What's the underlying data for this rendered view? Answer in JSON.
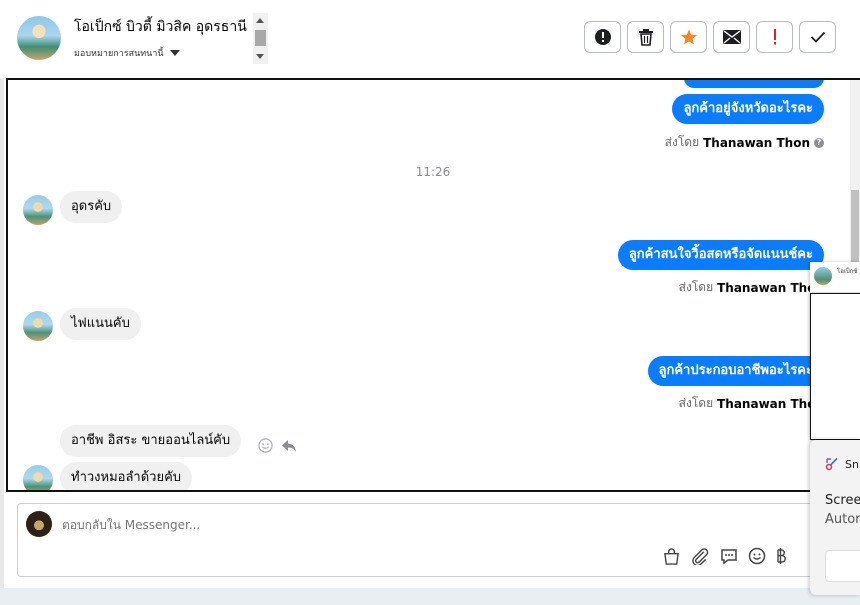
{
  "header": {
    "page_name": "โอเป็กซ์ บิวตี้ มิวสิค อุดรธานี",
    "assign_label": "มอบหมายการสนทนานี้",
    "actions": [
      {
        "icon": "alert-circle-icon",
        "name": "mark-spam-button"
      },
      {
        "icon": "trash-icon",
        "name": "delete-button"
      },
      {
        "icon": "star-icon",
        "name": "star-button"
      },
      {
        "icon": "envelope-icon",
        "name": "mark-unread-button"
      },
      {
        "icon": "exclamation-icon",
        "name": "follow-up-button"
      },
      {
        "icon": "check-icon",
        "name": "mark-done-button"
      }
    ]
  },
  "chat": {
    "messages": {
      "out1": "ลูกค้าอยู่จังหวัดอะไรคะ",
      "timestamp": "11:26",
      "in1": "อุดรคับ",
      "out2": "ลูกค้าสนใจวิ้อสดหรือจัดแนนช์คะ",
      "in2": "ไฟแนนคับ",
      "out3": "ลูกค้าประกอบอาชีพอะไรคะ",
      "in3": "อาชีพ อิสระ ขายออนไลน์คับ",
      "in4": "ทำวงหมอลำด้วยคับ"
    },
    "sent_by_prefix": "ส่งโดย",
    "sent_by_name": "Thanawan Thon",
    "info_glyph": "?"
  },
  "composer": {
    "placeholder": "ตอบกลับใน Messenger...",
    "tools": [
      "bag-icon",
      "paperclip-icon",
      "message-icon",
      "emoji-icon",
      "baht-icon"
    ]
  },
  "overlays": {
    "mini_chat_title": "โอเป็กซ์",
    "toast_title": "Sn",
    "toast_line1": "Screen",
    "toast_line2": "Autom"
  },
  "colors": {
    "accent": "#0a7cff",
    "star": "#f5871f",
    "alert_red": "#e02020"
  }
}
